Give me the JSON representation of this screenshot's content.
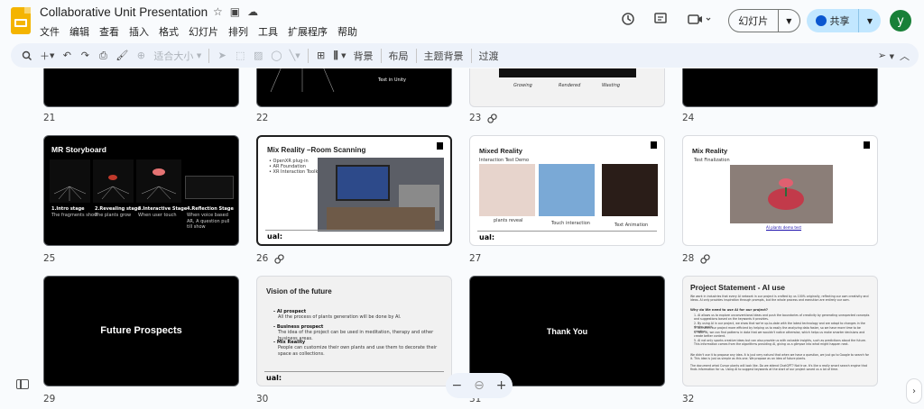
{
  "app": {
    "title": "Collaborative Unit Presentation",
    "menu": [
      "文件",
      "编辑",
      "查看",
      "插入",
      "格式",
      "幻灯片",
      "排列",
      "工具",
      "扩展程序",
      "帮助"
    ],
    "present_label": "幻灯片",
    "share_label": "共享",
    "avatar_letter": "y"
  },
  "toolbar": {
    "zoom_label": "适合大小",
    "background_label": "背景",
    "layout_label": "布局",
    "theme_label": "主题背景",
    "transition_label": "过渡"
  },
  "slides": {
    "s21": {
      "num": "21"
    },
    "s22": {
      "num": "22",
      "text": "Text in Unity"
    },
    "s23": {
      "num": "23",
      "labels": [
        "Growing",
        "Rendered",
        "Wasting"
      ]
    },
    "s24": {
      "num": "24"
    },
    "s25": {
      "num": "25",
      "title": "MR Storyboard",
      "stages": [
        {
          "name": "1.Intro stage",
          "desc": "The fragments show"
        },
        {
          "name": "2.Revealing stage",
          "desc": "The plants grow"
        },
        {
          "name": "3.Interactive Stage",
          "desc": "When user touch"
        },
        {
          "name": "4.Reflection Stage",
          "desc": "When voice based AR, A question pull till show"
        }
      ]
    },
    "s26": {
      "num": "26",
      "title": "Mix Reality –Room Scanning",
      "bullets": [
        "OpenXR plug-in",
        "AR Foundation",
        "XR Interaction Toolkit"
      ],
      "footer": "ual:"
    },
    "s27": {
      "num": "27",
      "title": "Mixed Reality",
      "subtitle": "Interaction Test Demo",
      "captions": [
        "plants reveal",
        "Touch interaction",
        "Text Animation"
      ],
      "footer": "ual:"
    },
    "s28": {
      "num": "28",
      "title": "Mix Reality",
      "subtitle": "Test Finalization",
      "caption": "AI plants demo test"
    },
    "s29": {
      "num": "29",
      "title": "Future Prospects"
    },
    "s30": {
      "num": "30",
      "title": "Vision of the future",
      "items": [
        {
          "head": "AI prospect",
          "body": "All the process of plants generation will be done by AI."
        },
        {
          "head": "Business prospect",
          "body": "The idea of the project can be used in meditation, therapy and other business areas."
        },
        {
          "head": "Mix Reality",
          "body": "People can customize their own plants and use them to decorate their space as collections."
        }
      ],
      "footer": "ual:"
    },
    "s31": {
      "num": "31",
      "title": "Thank You"
    },
    "s32": {
      "num": "32",
      "title": "Project Statement - AI use",
      "intro": "We work in industries that every AI network in our project is crafted by us 100% originally, reflecting our own creativity and ideas. AI only provides inspiration through prompts, but the whole process and execution are entirely our own.",
      "why_head": "Why do We need to use AI for our project?",
      "points": [
        "AI allows us to explore unconventional ideas and push the boundaries of creativity by generating unexpected concepts and suggestions based on the keywords it provides.",
        "By using AI in our project, we show that we're up-to-date with the latest technology and are adapt to changes in the design world.",
        "AI makes our project more efficient by helping us to easily the analyzing data faster, so we have more time to be creative.",
        "With AI, we can find patterns in data that we wouldn't notice otherwise, which helps us make smarter decisions and create better content.",
        "AI not only sparks creative ideas but can also provide us with valuable insights, such as predictions about the future. This information comes from the algorithms providing AI, giving us a glimpse into what might happen next."
      ],
      "outro": "We didn't use it to propose any idea. It is just very natural that when we have a question, we just go to Google to search for it. This idea is just as simple as this one. We propose as an idea of future plants.",
      "outro2": "The document what Cursor plants will look like. Do we attend ChatGPT? Not true. It's like a really smart search engine that finds information for us. Using AI to suggest keywords at the start of our project saved us a lot of time."
    }
  }
}
